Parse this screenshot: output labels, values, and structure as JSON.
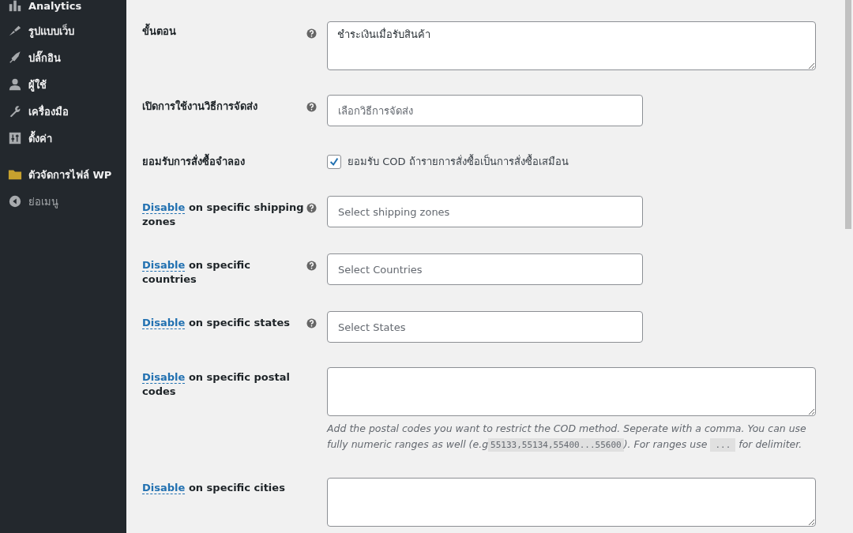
{
  "sidebar": {
    "items": [
      {
        "label": "Analytics",
        "selected": false
      },
      {
        "label": "รูปแบบเว็บ",
        "selected": false
      },
      {
        "label": "ปลั๊กอิน",
        "selected": false
      },
      {
        "label": "ผู้ใช้",
        "selected": false
      },
      {
        "label": "เครื่องมือ",
        "selected": false
      },
      {
        "label": "ตั้งค่า",
        "selected": false
      },
      {
        "label": "ตัวจัดการไฟล์ WP",
        "selected": false
      },
      {
        "label": "ย่อเมนู",
        "selected": false
      }
    ]
  },
  "settings": [
    {
      "kind": "textarea",
      "label": "ขั้นตอน",
      "help": true,
      "value": "ชำระเงินเมื่อรับสินค้า"
    },
    {
      "kind": "select",
      "label": "เปิดการใช้งานวิธีการจัดส่ง",
      "help": true,
      "placeholder": "เลือกวิธีการจัดส่ง"
    },
    {
      "kind": "checkbox",
      "label": "ยอมรับการสั่งซื้อจำลอง",
      "help": false,
      "checked": true,
      "option": "ยอมรับ COD ถ้ารายการสั่งซื้อเป็นการสั่งซื้อเสมือน"
    },
    {
      "kind": "select",
      "link": "Disable",
      "label": "on specific shipping zones",
      "help": true,
      "placeholder": "Select shipping zones"
    },
    {
      "kind": "select",
      "link": "Disable",
      "label": "on specific countries",
      "help": true,
      "placeholder": "Select Countries"
    },
    {
      "kind": "select",
      "link": "Disable",
      "label": "on specific states",
      "help": true,
      "placeholder": "Select States"
    },
    {
      "kind": "textarea",
      "link": "Disable",
      "label": "on specific postal codes",
      "help": false,
      "description": [
        "Add the postal codes you want to restrict the COD method. Seperate with a comma. You can use fully numeric ranges as well (e.g",
        "55133,55134,55400...55600",
        "). For ranges use",
        "...",
        "for delimiter."
      ]
    },
    {
      "kind": "textarea",
      "link": "Disable",
      "label": "on specific cities",
      "help": false
    }
  ]
}
